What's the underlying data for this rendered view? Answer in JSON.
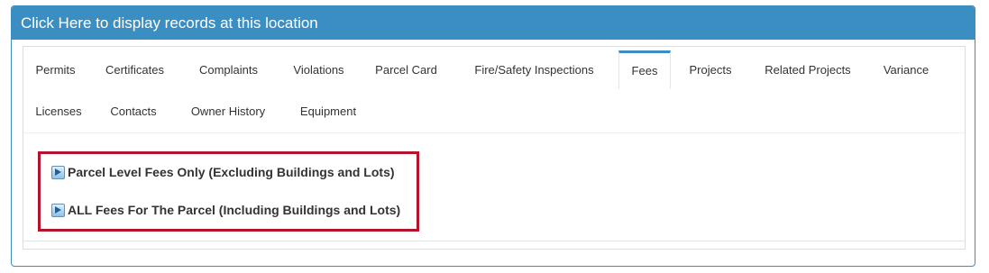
{
  "panel": {
    "header_title": "Click Here to display records at this location"
  },
  "tabs": {
    "row1": [
      {
        "key": "permits",
        "label": "Permits"
      },
      {
        "key": "certificates",
        "label": "Certificates"
      },
      {
        "key": "complaints",
        "label": "Complaints"
      },
      {
        "key": "violations",
        "label": "Violations"
      },
      {
        "key": "parcel-card",
        "label": "Parcel Card"
      },
      {
        "key": "fire-safety-inspections",
        "label": "Fire/Safety Inspections"
      },
      {
        "key": "fees",
        "label": "Fees"
      },
      {
        "key": "projects",
        "label": "Projects"
      },
      {
        "key": "related-projects",
        "label": "Related Projects"
      },
      {
        "key": "variance",
        "label": "Variance"
      }
    ],
    "row2": [
      {
        "key": "licenses",
        "label": "Licenses"
      },
      {
        "key": "contacts",
        "label": "Contacts"
      },
      {
        "key": "owner-history",
        "label": "Owner History"
      },
      {
        "key": "equipment",
        "label": "Equipment"
      }
    ],
    "active": "Fees"
  },
  "fees": {
    "links": [
      {
        "label": "Parcel Level Fees Only (Excluding Buildings and Lots)",
        "icon": "play-icon"
      },
      {
        "label": "ALL Fees For The Parcel (Including Buildings and Lots)",
        "icon": "play-icon"
      }
    ]
  },
  "colors": {
    "header_bg": "#3b8ec2",
    "highlight_border": "#b5122b"
  }
}
